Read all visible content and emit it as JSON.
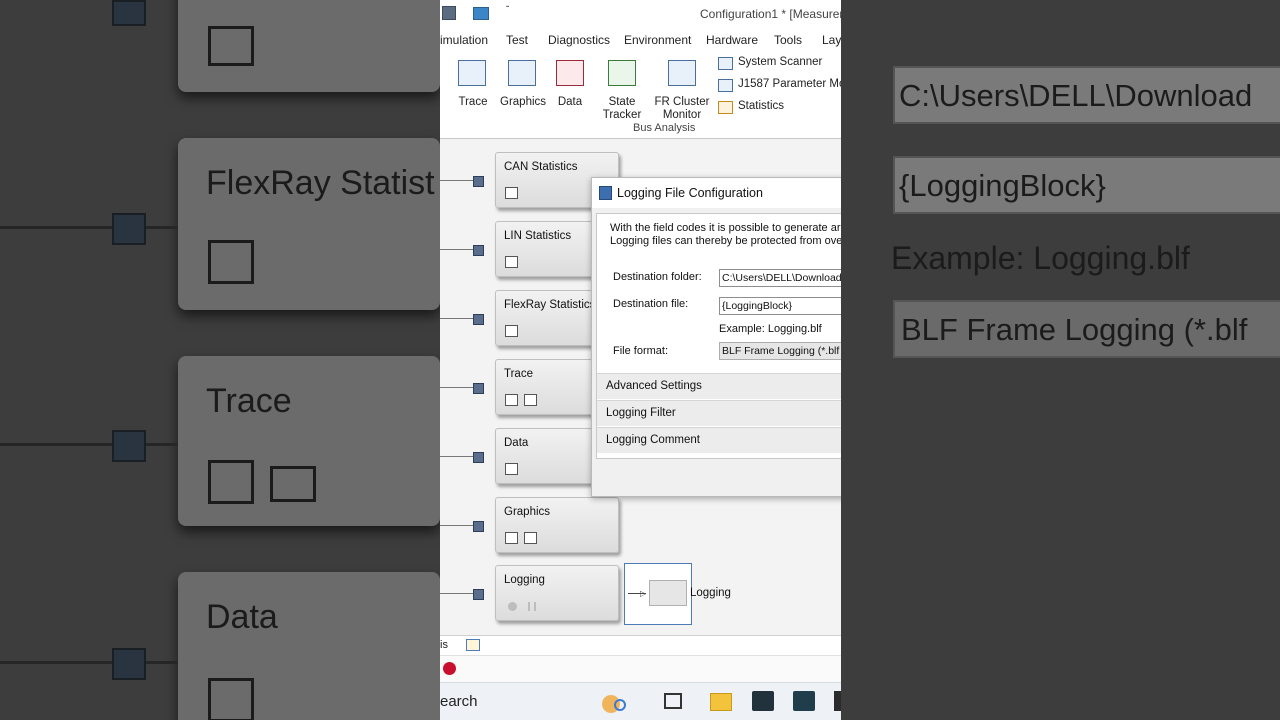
{
  "window": {
    "title": "Configuration1 * [Measureme"
  },
  "menu": {
    "items": [
      "imulation",
      "Test",
      "Diagnostics",
      "Environment",
      "Hardware",
      "Tools",
      "Lay"
    ]
  },
  "ribbon": {
    "buttons": {
      "trace": "Trace",
      "graphics": "Graphics",
      "data": "Data",
      "state_tracker_1": "State",
      "state_tracker_2": "Tracker",
      "fr_cluster_1": "FR Cluster",
      "fr_cluster_2": "Monitor"
    },
    "small_buttons": [
      "System Scanner",
      "J1587 Parameter Mon",
      "Statistics"
    ],
    "group_label": "Bus Analysis"
  },
  "measurement_setup": {
    "blocks": [
      "CAN Statistics",
      "LIN Statistics",
      "FlexRay Statistics",
      "Trace",
      "Data",
      "Graphics",
      "Logging"
    ],
    "logging_node_label": "Logging"
  },
  "dialog": {
    "title": "Logging File Configuration",
    "description_line1": "With the field codes it is possible to generate ar",
    "description_line2": "Logging files can thereby be protected from ove",
    "destination_folder_label": "Destination folder:",
    "destination_folder_value": "C:\\Users\\DELL\\Download",
    "destination_file_label": "Destination file:",
    "destination_file_value": "{LoggingBlock}",
    "example": "Example: Logging.blf",
    "file_format_label": "File format:",
    "file_format_value": "BLF Frame Logging (*.blf",
    "sections": [
      "Advanced Settings",
      "Logging Filter",
      "Logging Comment"
    ]
  },
  "statusbar": {
    "left_text": "is"
  },
  "taskbar": {
    "search_text": "earch"
  },
  "background": {
    "left_texts": [
      "FlexRay Statist",
      "Trace",
      "Data"
    ],
    "right_texts": [
      "C:\\Users\\DELL\\Download",
      "{LoggingBlock}",
      "Example: Logging.blf",
      "BLF Frame Logging (*.blf"
    ]
  },
  "colors": {
    "accent": "#4a6f9c",
    "node": "#5a6d8c",
    "block_gradient_top": "#f2f2f2",
    "block_gradient_bottom": "#dcdcdc"
  }
}
